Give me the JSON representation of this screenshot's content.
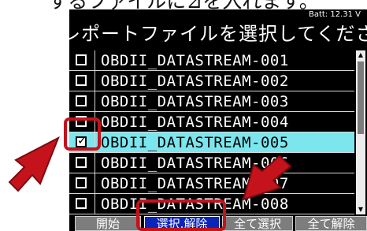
{
  "document_caption": "するファイルに⊿を入れます。",
  "status": {
    "battery": "Batt: 12.31 V"
  },
  "screen": {
    "title": "レポートファイルを選択してください"
  },
  "file_list": {
    "items": [
      {
        "name": "OBDII_DATASTREAM-001",
        "checked": false
      },
      {
        "name": "OBDII_DATASTREAM-002",
        "checked": false
      },
      {
        "name": "OBDII_DATASTREAM-003",
        "checked": false
      },
      {
        "name": "OBDII_DATASTREAM-004",
        "checked": false
      },
      {
        "name": "OBDII_DATASTREAM-005",
        "checked": true,
        "check_symbol": "✓"
      },
      {
        "name": "OBDII_DATASTREAM-006",
        "checked": false
      },
      {
        "name": "OBDII_DATASTREAM-007",
        "checked": false
      },
      {
        "name": "OBDII_DATASTREAM-008",
        "checked": false
      }
    ]
  },
  "buttons": {
    "start": "開始",
    "toggle_select": "選択.解除",
    "select_all": "全て選択",
    "deselect_all": "全て解除"
  },
  "colors": {
    "screen_background": "#000000",
    "selected_row": "#7be6ee",
    "active_button": "#0a25b8",
    "button": "#7d7d7d",
    "annotation": "#c5131c"
  }
}
